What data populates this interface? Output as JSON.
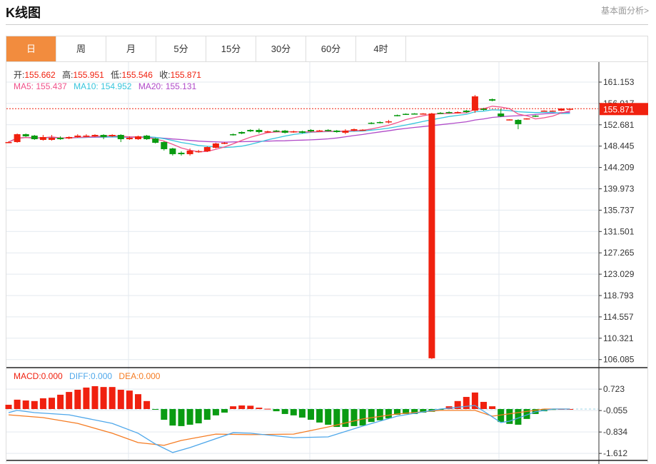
{
  "header": {
    "title": "K线图",
    "link": "基本面分析>"
  },
  "tabs": [
    {
      "label": "日",
      "active": true
    },
    {
      "label": "周"
    },
    {
      "label": "月"
    },
    {
      "label": "5分"
    },
    {
      "label": "15分"
    },
    {
      "label": "30分"
    },
    {
      "label": "60分"
    },
    {
      "label": "4时"
    }
  ],
  "ohlc": {
    "open_label": "开:",
    "open": "155.662",
    "high_label": "高:",
    "high": "155.951",
    "low_label": "低:",
    "low": "155.546",
    "close_label": "收:",
    "close": "155.871"
  },
  "ma": {
    "ma5": "MA5: 155.437",
    "ma10": "MA10: 154.952",
    "ma20": "MA20: 155.131"
  },
  "macd_info": {
    "macd": "MACD:0.000",
    "diff": "DIFF:0.000",
    "dea": "DEA:0.000"
  },
  "colors": {
    "up": "#f0210f",
    "down": "#0a9b12",
    "ma5": "#f0508a",
    "ma10": "#36c5dc",
    "ma20": "#b04ac8",
    "diff": "#4ea7ea",
    "dea": "#f57c23",
    "tab_active": "#f28c3e"
  },
  "chart_data": [
    {
      "type": "candlestick",
      "title": "K线图",
      "ylim": [
        106.085,
        161.153
      ],
      "yticks": [
        "161.153",
        "156.917",
        "152.681",
        "148.445",
        "144.209",
        "139.973",
        "135.737",
        "131.501",
        "127.265",
        "123.029",
        "118.793",
        "114.557",
        "110.321",
        "106.085"
      ],
      "last_price": "155.871",
      "candles_ohlc": [
        [
          149.25,
          149.4,
          149.1,
          149.25
        ],
        [
          149.25,
          150.95,
          149.11,
          150.81
        ],
        [
          150.81,
          150.95,
          150.25,
          150.39
        ],
        [
          150.53,
          150.67,
          149.68,
          149.82
        ],
        [
          149.68,
          150.67,
          149.54,
          150.25
        ],
        [
          149.68,
          150.67,
          149.54,
          150.1
        ],
        [
          150.1,
          150.39,
          149.68,
          149.82
        ],
        [
          149.96,
          150.39,
          149.82,
          150.25
        ],
        [
          150.25,
          150.81,
          150.1,
          150.53
        ],
        [
          150.39,
          150.81,
          150.25,
          150.53
        ],
        [
          150.39,
          150.81,
          150.25,
          150.67
        ],
        [
          150.67,
          150.81,
          149.82,
          150.25
        ],
        [
          150.39,
          150.81,
          150.25,
          150.67
        ],
        [
          150.67,
          150.81,
          149.25,
          149.82
        ],
        [
          149.82,
          150.39,
          149.68,
          150.1
        ],
        [
          149.82,
          150.53,
          149.68,
          150.39
        ],
        [
          150.53,
          150.67,
          149.68,
          149.82
        ],
        [
          149.96,
          150.1,
          148.97,
          149.11
        ],
        [
          149.25,
          149.4,
          147.56,
          147.84
        ],
        [
          147.98,
          148.12,
          146.56,
          146.85
        ],
        [
          147.13,
          147.41,
          146.56,
          146.85
        ],
        [
          146.85,
          147.98,
          146.56,
          147.56
        ],
        [
          147.41,
          147.7,
          147.13,
          147.45
        ],
        [
          147.41,
          148.4,
          147.27,
          148.26
        ],
        [
          148.12,
          149.11,
          147.98,
          148.97
        ],
        [
          148.97,
          149.25,
          148.83,
          149.11
        ],
        [
          150.81,
          150.95,
          150.53,
          150.67
        ],
        [
          151.24,
          151.38,
          150.81,
          150.95
        ],
        [
          151.66,
          151.8,
          151.24,
          151.38
        ],
        [
          151.66,
          151.95,
          150.95,
          151.24
        ],
        [
          151.24,
          151.52,
          151.1,
          151.38
        ],
        [
          151.52,
          151.66,
          151.24,
          151.38
        ],
        [
          151.52,
          151.66,
          150.95,
          151.1
        ],
        [
          151.24,
          151.52,
          151.1,
          151.38
        ],
        [
          151.38,
          151.52,
          150.95,
          151.1
        ],
        [
          151.66,
          151.8,
          151.24,
          151.38
        ],
        [
          151.52,
          151.66,
          151.38,
          151.55
        ],
        [
          151.66,
          151.8,
          151.38,
          151.52
        ],
        [
          151.52,
          151.66,
          151.1,
          151.24
        ],
        [
          151.1,
          151.8,
          150.81,
          151.52
        ],
        [
          151.52,
          151.95,
          151.38,
          151.8
        ],
        [
          151.66,
          151.8,
          151.52,
          151.7
        ],
        [
          153.08,
          153.22,
          152.8,
          152.94
        ],
        [
          153.22,
          153.36,
          152.94,
          153.08
        ],
        [
          153.22,
          153.65,
          152.94,
          153.36
        ],
        [
          154.6,
          154.7,
          154.35,
          154.45
        ],
        [
          154.85,
          154.95,
          154.65,
          154.78
        ],
        [
          154.92,
          155.0,
          154.75,
          154.85
        ],
        [
          154.85,
          155.0,
          154.78,
          154.92
        ],
        [
          106.34,
          155.06,
          106.2,
          154.92
        ],
        [
          155.06,
          155.2,
          154.85,
          154.92
        ],
        [
          155.2,
          155.35,
          154.92,
          155.06
        ],
        [
          155.06,
          155.35,
          154.92,
          155.2
        ],
        [
          155.49,
          155.63,
          155.06,
          155.2
        ],
        [
          155.49,
          158.6,
          155.06,
          158.32
        ],
        [
          155.91,
          156.05,
          155.49,
          155.63
        ],
        [
          157.75,
          157.9,
          157.33,
          157.47
        ],
        [
          154.92,
          155.91,
          154.21,
          154.35
        ],
        [
          153.65,
          153.79,
          153.55,
          153.75
        ],
        [
          153.65,
          153.79,
          151.8,
          152.8
        ],
        [
          153.79,
          154.0,
          153.7,
          153.95
        ],
        [
          154.5,
          154.6,
          154.2,
          154.35
        ],
        [
          155.35,
          155.55,
          155.3,
          155.49
        ],
        [
          155.35,
          155.55,
          155.3,
          155.49
        ],
        [
          155.49,
          155.95,
          155.4,
          155.91
        ],
        [
          155.662,
          155.951,
          155.546,
          155.871
        ]
      ]
    },
    {
      "type": "macd",
      "ylim": [
        -1.75,
        1.0
      ],
      "yticks": [
        "0.723",
        "-0.055",
        "-0.834",
        "-1.612"
      ],
      "ytick_values": [
        0.723,
        -0.055,
        -0.834,
        -1.612
      ],
      "histogram": [
        0.155,
        0.34,
        0.31,
        0.29,
        0.39,
        0.41,
        0.52,
        0.62,
        0.7,
        0.78,
        0.83,
        0.8,
        0.8,
        0.7,
        0.67,
        0.54,
        0.29,
        -0.02,
        -0.39,
        -0.6,
        -0.62,
        -0.57,
        -0.52,
        -0.39,
        -0.23,
        -0.13,
        0.1,
        0.13,
        0.12,
        0.05,
        0.01,
        -0.08,
        -0.18,
        -0.23,
        -0.31,
        -0.39,
        -0.49,
        -0.57,
        -0.65,
        -0.65,
        -0.62,
        -0.6,
        -0.47,
        -0.41,
        -0.34,
        -0.21,
        -0.18,
        -0.18,
        -0.13,
        -0.1,
        -0.03,
        0.1,
        0.29,
        0.44,
        0.6,
        0.26,
        0.1,
        -0.47,
        -0.54,
        -0.57,
        -0.36,
        -0.18,
        -0.08,
        -0.03,
        0.0,
        0.0
      ],
      "diff": [
        [
          0,
          -0.13
        ],
        [
          1,
          -0.05
        ],
        [
          3,
          -0.13
        ],
        [
          7,
          -0.21
        ],
        [
          12,
          -0.52
        ],
        [
          15,
          -0.88
        ],
        [
          17,
          -1.27
        ],
        [
          19,
          -1.58
        ],
        [
          21,
          -1.4
        ],
        [
          26,
          -0.86
        ],
        [
          28,
          -0.88
        ],
        [
          33,
          -1.04
        ],
        [
          37,
          -1.01
        ],
        [
          41,
          -0.62
        ],
        [
          45,
          -0.26
        ],
        [
          50,
          0.0
        ],
        [
          54,
          0.13
        ],
        [
          57,
          -0.49
        ],
        [
          58,
          -0.44
        ],
        [
          61,
          -0.1
        ],
        [
          63,
          0.0
        ],
        [
          65,
          0.0
        ]
      ],
      "dea": [
        [
          0,
          -0.21
        ],
        [
          4,
          -0.31
        ],
        [
          8,
          -0.52
        ],
        [
          12,
          -0.88
        ],
        [
          15,
          -1.22
        ],
        [
          18,
          -1.32
        ],
        [
          20,
          -1.14
        ],
        [
          24,
          -0.91
        ],
        [
          28,
          -0.93
        ],
        [
          33,
          -0.91
        ],
        [
          37,
          -0.65
        ],
        [
          41,
          -0.36
        ],
        [
          45,
          -0.18
        ],
        [
          50,
          -0.05
        ],
        [
          54,
          -0.05
        ],
        [
          56,
          -0.26
        ],
        [
          59,
          -0.13
        ],
        [
          62,
          0.0
        ],
        [
          65,
          0.0
        ]
      ]
    }
  ]
}
